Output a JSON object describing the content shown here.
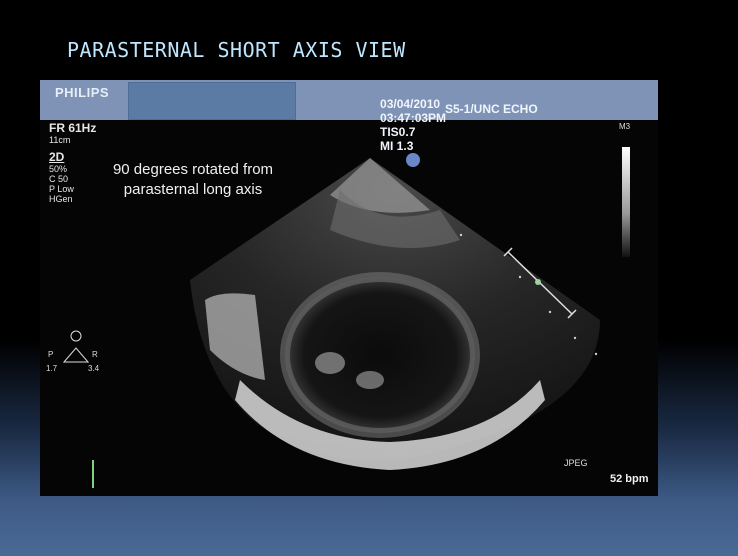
{
  "slide": {
    "title": "PARASTERNAL SHORT AXIS VIEW"
  },
  "header": {
    "brand": "PHILIPS",
    "date": "03/04/2010",
    "time": "03:47:03PM",
    "tis": "TIS0.7",
    "mi": "MI 1.3",
    "probe": "S5-1/UNC ECHO"
  },
  "params": {
    "frame_rate": "FR 61Hz",
    "depth": "11cm",
    "mode": "2D",
    "gain": "50%",
    "compression": "C 50",
    "power": "P Low",
    "harmonic": "HGen"
  },
  "annotation": "90 degrees rotated from parasternal long axis",
  "orientation": {
    "left": "P",
    "right": "R",
    "value_left": "1.7",
    "value_right": "3.4"
  },
  "scale_label": "M3",
  "format_label": "JPEG",
  "heart_rate": "52 bpm"
}
